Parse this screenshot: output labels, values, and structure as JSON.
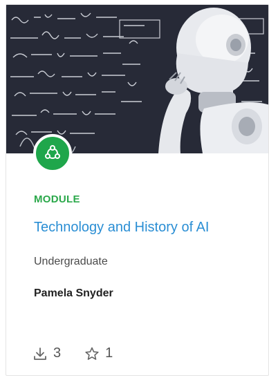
{
  "card": {
    "type_label": "MODULE",
    "title": "Technology and History of AI",
    "level": "Undergraduate",
    "author": "Pamela Snyder",
    "downloads": "3",
    "favorites": "1",
    "badge_icon": "module-network-icon",
    "download_icon": "download-icon",
    "favorite_icon": "star-icon",
    "accent_color": "#1fa64b",
    "title_color": "#2a8ed4"
  }
}
